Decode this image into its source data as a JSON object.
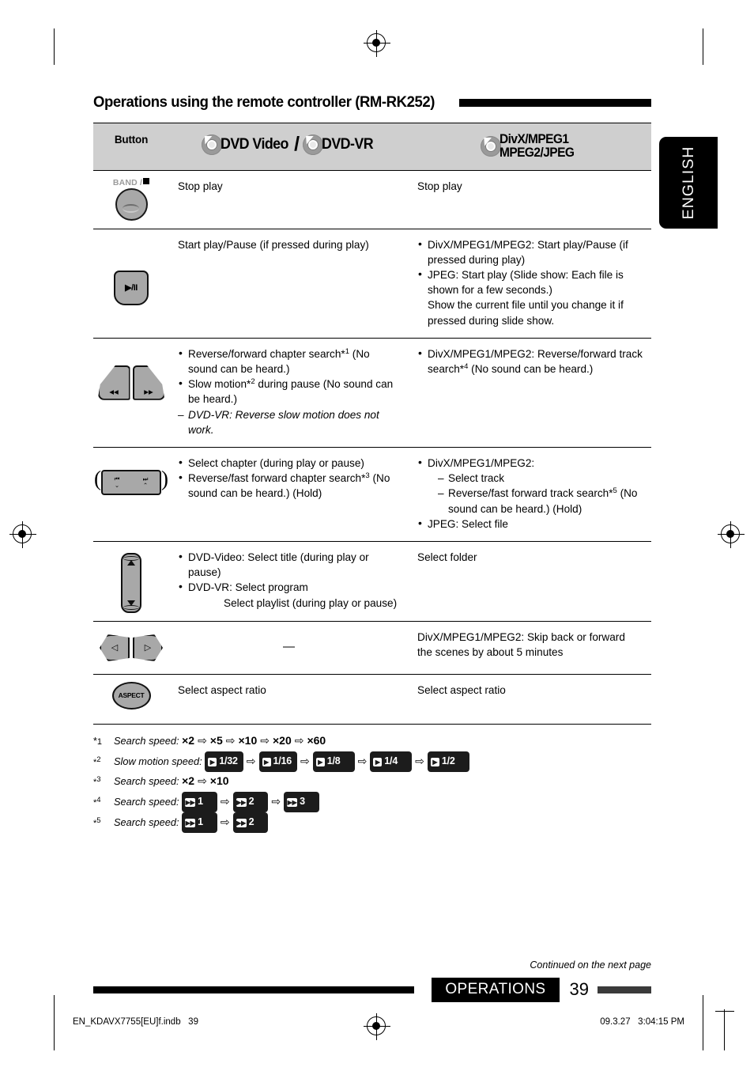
{
  "page": {
    "title": "Operations using the remote controller (RM-RK252)",
    "language_tab": "ENGLISH",
    "continued_note": "Continued on the next page",
    "footer_section": "OPERATIONS",
    "page_number": "39",
    "print_file": "EN_KDAVX7755[EU]f.indb   39",
    "print_timestamp": "09.3.27   3:04:15 PM"
  },
  "table": {
    "headers": {
      "button": "Button",
      "col_a_disc1": "DVD Video",
      "col_a_sep": "/",
      "col_a_disc2": "DVD-VR",
      "col_b_line1": "DivX/MPEG1",
      "col_b_line2": "MPEG2/JPEG"
    },
    "rows": [
      {
        "button_name": "band-stop-button",
        "button_label": "BAND /",
        "col_a": [
          "Stop play"
        ],
        "col_b": [
          "Stop play"
        ]
      },
      {
        "button_name": "play-pause-button",
        "button_label": "▶/II",
        "col_a": [
          "Start play/Pause (if pressed during play)"
        ],
        "col_b": [
          "DivX/MPEG1/MPEG2: Start play/Pause (if pressed during play)",
          "JPEG: Start play (Slide show: Each file is shown for a few seconds.)",
          "Show the current file until you change it if pressed during slide show."
        ]
      },
      {
        "button_name": "reverse-forward-wing-buttons",
        "button_label_left": "◀◀",
        "button_label_right": "▶▶",
        "col_a_items": [
          "Reverse/forward chapter search*1 (No sound can be heard.)",
          "Slow motion*2 during pause (No sound can be heard.)"
        ],
        "col_a_dash": "DVD-VR: Reverse slow motion does not work.",
        "col_b_items": [
          "DivX/MPEG1/MPEG2: Reverse/forward track search*4 (No sound can be heard.)"
        ]
      },
      {
        "button_name": "track-rocker-buttons",
        "col_a_items": [
          "Select chapter (during play or pause)",
          "Reverse/fast forward chapter search*3 (No sound can be heard.) (Hold)"
        ],
        "col_b_head": "DivX/MPEG1/MPEG2:",
        "col_b_sub": [
          "Select track",
          "Reverse/fast forward track search*5 (No sound can be heard.) (Hold)"
        ],
        "col_b_last": "JPEG: Select file"
      },
      {
        "button_name": "up-down-stick-button",
        "col_a_items": [
          "DVD-Video: Select title (during play or pause)",
          "DVD-VR:  Select program"
        ],
        "col_a_indent": "Select playlist (during play or pause)",
        "col_b": [
          "Select folder"
        ]
      },
      {
        "button_name": "left-right-arrow-buttons",
        "col_a_dash_only": "—",
        "col_b": [
          "DivX/MPEG1/MPEG2: Skip back or forward the scenes by about 5 minutes"
        ]
      },
      {
        "button_name": "aspect-button",
        "button_label": "ASPECT",
        "col_a": [
          "Select aspect ratio"
        ],
        "col_b": [
          "Select aspect ratio"
        ]
      }
    ]
  },
  "footnotes": [
    {
      "marker": "*1",
      "label": "Search speed:",
      "steps": [
        "×2",
        "×5",
        "×10",
        "×20",
        "×60"
      ],
      "style": "plain"
    },
    {
      "marker": "*2",
      "label": "Slow motion speed:",
      "steps": [
        "1/32",
        "1/16",
        "1/8",
        "1/4",
        "1/2"
      ],
      "style": "chip-slow"
    },
    {
      "marker": "*3",
      "label": "Search speed:",
      "steps": [
        "×2",
        "×10"
      ],
      "style": "plain"
    },
    {
      "marker": "*4",
      "label": "Search speed:",
      "steps": [
        "1",
        "2",
        "3"
      ],
      "style": "chip-ff"
    },
    {
      "marker": "*5",
      "label": "Search speed:",
      "steps": [
        "1",
        "2"
      ],
      "style": "chip-ff"
    }
  ]
}
